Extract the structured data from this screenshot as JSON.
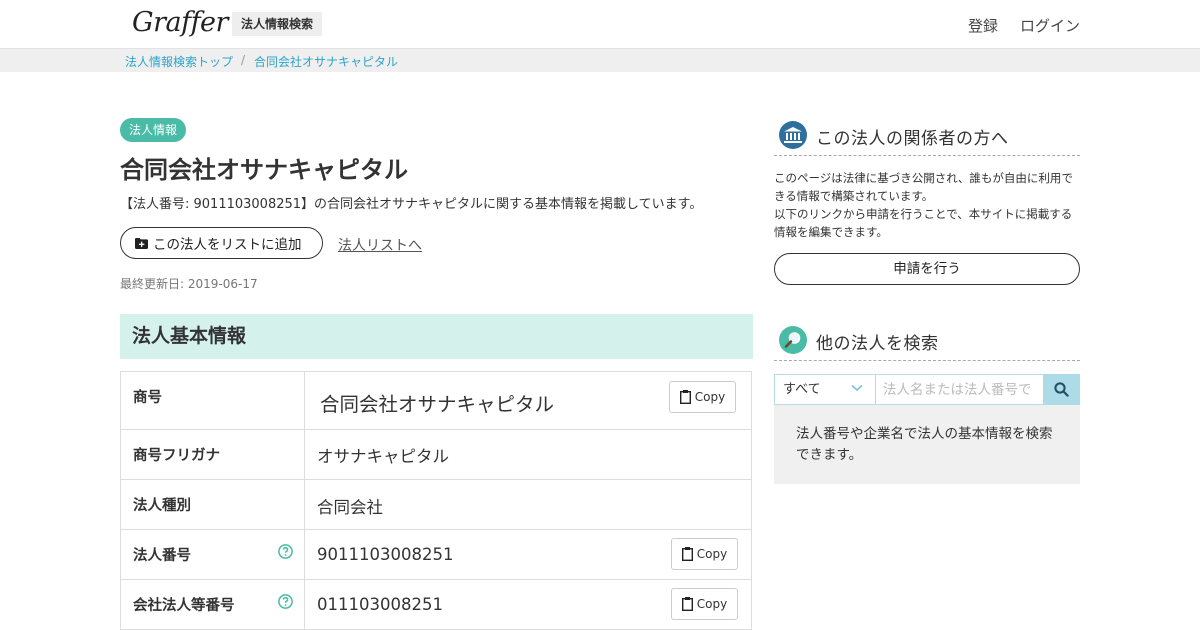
{
  "header": {
    "logo": "Graffer",
    "service_tag": "法人情報検索",
    "nav": {
      "register": "登録",
      "login": "ログイン"
    }
  },
  "breadcrumb": {
    "items": [
      "法人情報検索トップ",
      "合同会社オサナキャピタル"
    ],
    "separator": "/"
  },
  "main": {
    "badge": "法人情報",
    "title": "合同会社オサナキャピタル",
    "description": "【法人番号: 9011103008251】の合同会社オサナキャピタルに関する基本情報を掲載しています。",
    "add_to_list_label": "この法人をリストに追加",
    "list_link_label": "法人リストへ",
    "last_updated": "最終更新日: 2019-06-17",
    "section_title": "法人基本情報",
    "rows": [
      {
        "label": "商号",
        "value": "合同会社オサナキャピタル",
        "copy": "Copy"
      },
      {
        "label": "商号フリガナ",
        "value": "オサナキャピタル"
      },
      {
        "label": "法人種別",
        "value": "合同会社"
      },
      {
        "label": "法人番号",
        "value": "9011103008251",
        "copy": "Copy"
      },
      {
        "label": "会社法人等番号",
        "value": "011103008251",
        "copy": "Copy"
      }
    ]
  },
  "sidebar": {
    "related": {
      "heading": "この法人の関係者の方へ",
      "note_1": "このページは法律に基づき公開され、誰もが自由に利用できる情報で構築されています。",
      "note_2": "以下のリンクから申請を行うことで、本サイトに掲載する情報を編集できます。",
      "apply_label": "申請を行う"
    },
    "search": {
      "heading": "他の法人を検索",
      "select_value": "すべて",
      "placeholder": "法人名または法人番号で",
      "info": "法人番号や企業名で法人の基本情報を検索できます。"
    }
  },
  "colors": {
    "accent": "#49bba6",
    "section_bg": "#d5f1ec",
    "link": "#2ea3c8",
    "search_button": "#aedbe8"
  }
}
